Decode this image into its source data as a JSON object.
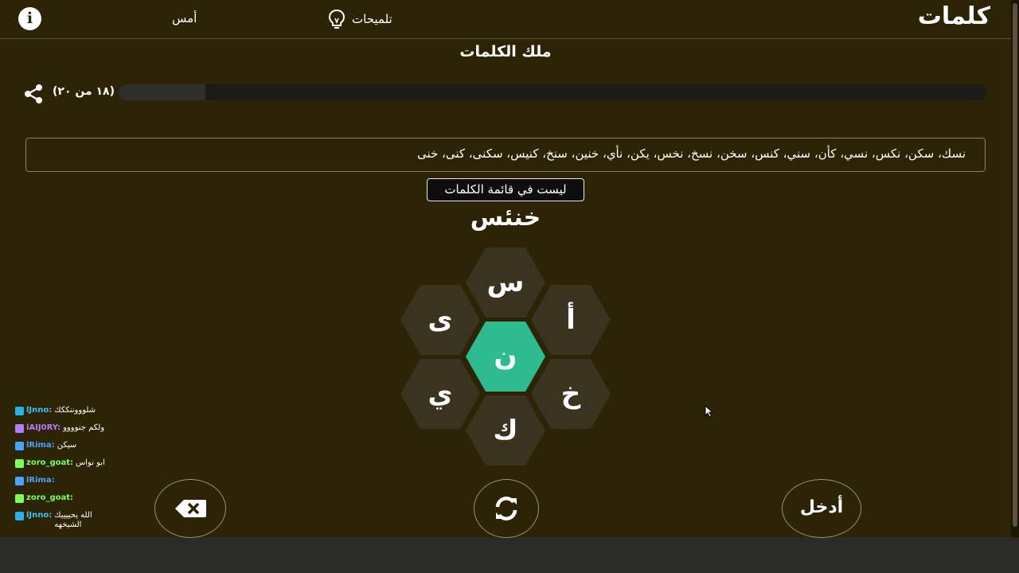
{
  "header": {
    "brand": "كلمات",
    "hints_label": "تلميحات",
    "yesterday_label": "أمس",
    "info_icon": "info-icon"
  },
  "rank": {
    "title": "ملك الكلمات",
    "count_text": "(١٨ من ٢٠)",
    "progress": 0.1
  },
  "found_words": "نسك، سكن، نكس، نسي، كأن، سني، كنس، سخن، نسخ، نخس، يكن، نأي، خنين، سنخ، كنيس، سكنى، كنى، خنى",
  "toast": "ليست في قائمة الكلمات",
  "current_word": "خنئس",
  "letters": {
    "center": "ن",
    "top": "س",
    "upper_left": "ى",
    "upper_right": "أ",
    "lower_left": "ي",
    "lower_right": "خ",
    "bottom": "ك"
  },
  "controls": {
    "enter_label": "أدخل",
    "delete_icon": "backspace-icon",
    "shuffle_icon": "shuffle-icon"
  },
  "chat": [
    {
      "user": "lJnno:",
      "message": "شلوووننككك",
      "color": "#3ec0ff",
      "badge": "#2bb0e8"
    },
    {
      "user": "iAIJ0RY:",
      "message": "ولكم جنوووو",
      "color": "#b57cff",
      "badge": "#b57cff"
    },
    {
      "user": "lRima:",
      "message": "سيكن",
      "color": "#4aa3ff",
      "badge": "#4aa3ff"
    },
    {
      "user": "zoro_goat:",
      "message": "ابو نواس",
      "color": "#7cff5a",
      "badge": "#7cff5a"
    },
    {
      "user": "lRima:",
      "message": "",
      "color": "#4aa3ff",
      "badge": "#4aa3ff"
    },
    {
      "user": "zoro_goat:",
      "message": "",
      "color": "#7cff5a",
      "badge": "#7cff5a"
    },
    {
      "user": "lJnno:",
      "message": "الله يحييييك الشيخهه",
      "color": "#3ec0ff",
      "badge": "#2bb0e8"
    }
  ],
  "colors": {
    "background": "#2d2305",
    "accent": "#2dbb8f",
    "hex": "#3a3320"
  }
}
